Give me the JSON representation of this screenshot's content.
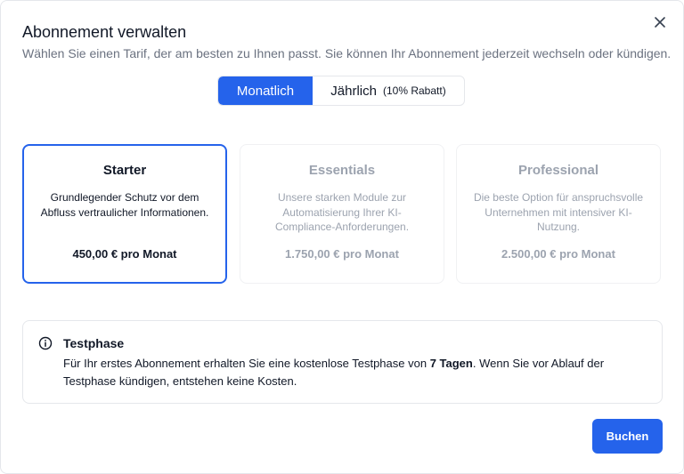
{
  "dialog": {
    "title": "Abonnement verwalten",
    "subtitle": "Wählen Sie einen Tarif, der am besten zu Ihnen passt. Sie können Ihr Abonnement jederzeit wechseln oder kündigen.",
    "close_icon": "close-icon"
  },
  "billing_toggle": {
    "monthly_label": "Monatlich",
    "yearly_label": "Jährlich",
    "yearly_note": "(10% Rabatt)",
    "selected": "Monatlich"
  },
  "plans": [
    {
      "name": "Starter",
      "description": "Grundlegender Schutz vor dem Abfluss vertraulicher Informationen.",
      "price": "450,00 € pro Monat",
      "selected": true
    },
    {
      "name": "Essentials",
      "description": "Unsere starken Module zur Automatisierung Ihrer KI-Compliance-Anforderungen.",
      "price": "1.750,00 € pro Monat",
      "selected": false
    },
    {
      "name": "Professional",
      "description": "Die beste Option für anspruchsvolle Unternehmen mit intensiver KI-Nutzung.",
      "price": "2.500,00 € pro Monat",
      "selected": false
    }
  ],
  "trial": {
    "icon": "info-icon",
    "title": "Testphase",
    "text_before": "Für Ihr erstes Abonnement erhalten Sie eine kostenlose Testphase von ",
    "text_bold": "7 Tagen",
    "text_after": ". Wenn Sie vor Ablauf der Testphase kündigen, entstehen keine Kosten."
  },
  "actions": {
    "buy_label": "Buchen"
  },
  "colors": {
    "accent": "#2563eb",
    "muted_text": "#9ca3af",
    "subtitle_text": "#6b7280"
  }
}
